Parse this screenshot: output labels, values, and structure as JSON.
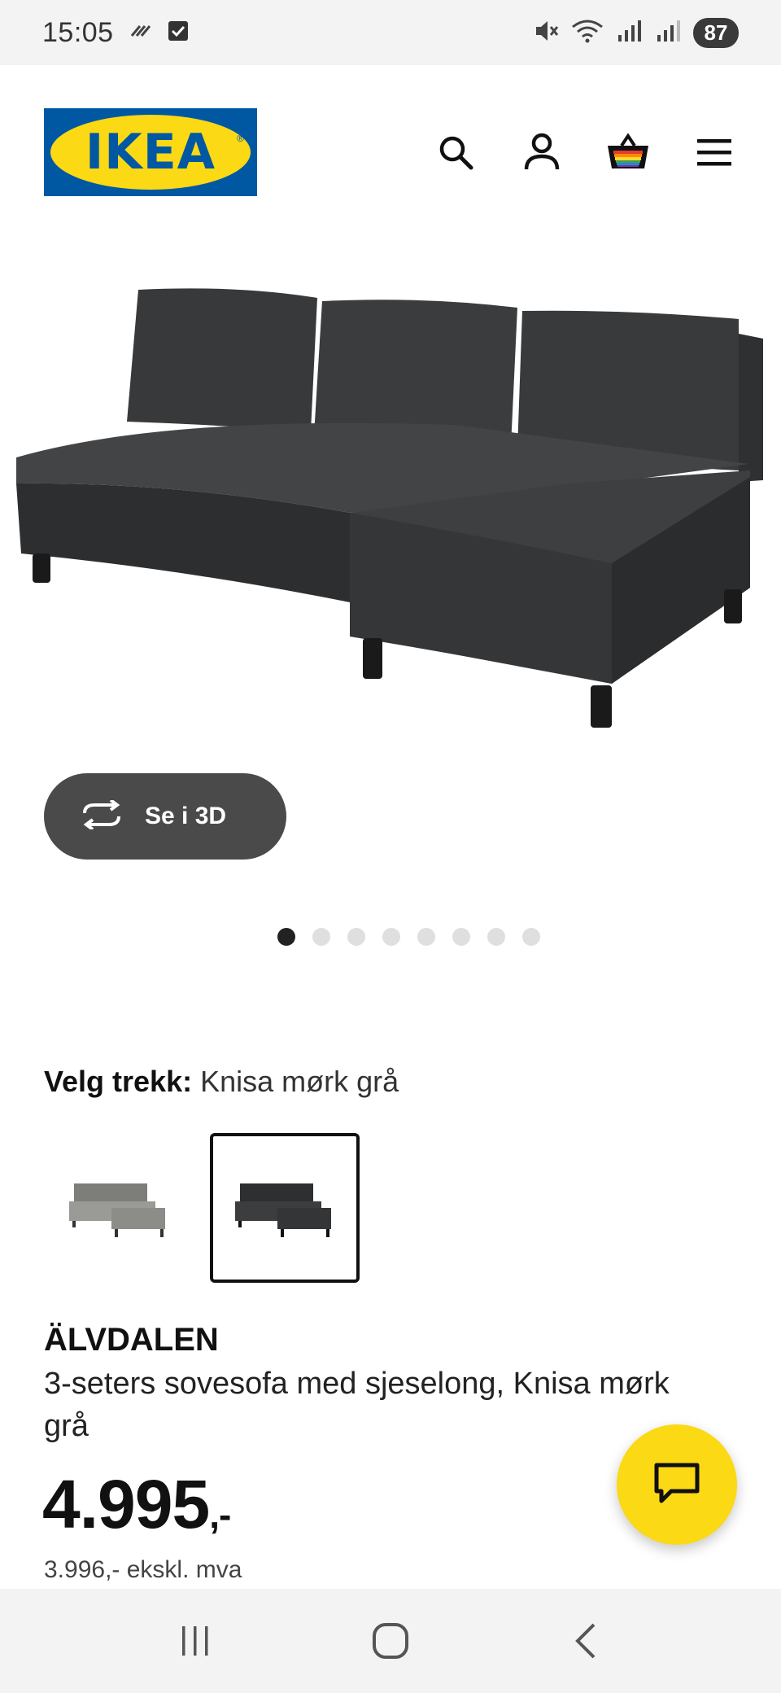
{
  "status_bar": {
    "time": "15:05",
    "battery": "87",
    "icons": [
      "unknown-icon",
      "checkbox-notification-icon",
      "mute-icon",
      "wifi-icon",
      "signal-r-icon",
      "signal-icon"
    ]
  },
  "header": {
    "logo_text": "IKEA",
    "logo_colors": {
      "blue": "#0058a3",
      "yellow": "#fbd914"
    },
    "icons": [
      "search-icon",
      "account-icon",
      "cart-icon",
      "menu-icon"
    ]
  },
  "gallery": {
    "view_3d_label": "Se i 3D",
    "view_3d_icon": "rotate-3d-icon",
    "total_images": 8,
    "active_index": 0
  },
  "variant": {
    "label": "Velg trekk:",
    "selected_value": "Knisa mørk grå",
    "options": [
      {
        "name": "light-grey",
        "color": "#8a8a86",
        "selected": false
      },
      {
        "name": "dark-grey",
        "color": "#3a3b3c",
        "selected": true
      }
    ]
  },
  "product": {
    "name": "ÄLVDALEN",
    "description": "3-seters sovesofa med sjeselong, Knisa mørk grå",
    "price": "4.995",
    "price_suffix": ",-",
    "price_ex_vat": "3.996,- ekskl. mva"
  },
  "chat": {
    "icon": "chat-bubble-icon",
    "color": "#fbd914"
  },
  "nav_bar": {
    "buttons": [
      "recent-apps-icon",
      "home-icon",
      "back-icon"
    ]
  }
}
